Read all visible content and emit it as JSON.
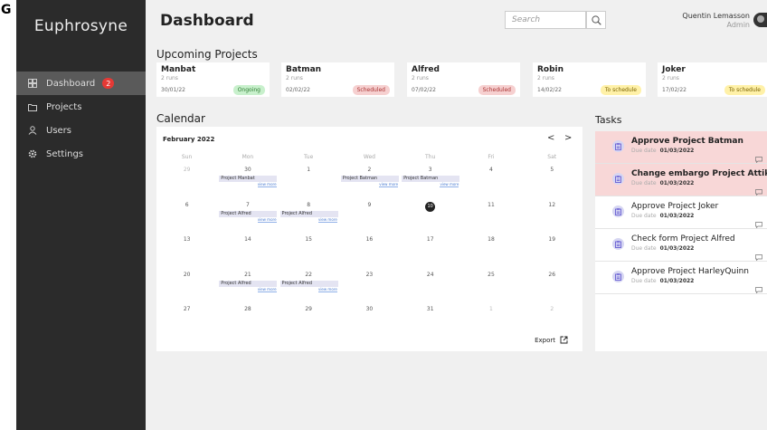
{
  "edge": {
    "glyph": "G"
  },
  "sidebar": {
    "brand": "Euphrosyne",
    "items": [
      {
        "label": "Dashboard",
        "badge": "2",
        "icon": "dashboard-icon",
        "active": true
      },
      {
        "label": "Projects",
        "icon": "folder-icon"
      },
      {
        "label": "Users",
        "icon": "user-icon"
      },
      {
        "label": "Settings",
        "icon": "gear-icon"
      }
    ]
  },
  "header": {
    "title": "Dashboard",
    "search_placeholder": "Search",
    "user_name": "Quentin Lemasson",
    "user_role": "Admin"
  },
  "projects": {
    "title": "Upcoming Projects",
    "items": [
      {
        "name": "Manbat",
        "runs": "2 runs",
        "date": "30/01/22",
        "status": "Ongoing",
        "status_color": "#c8f0cc"
      },
      {
        "name": "Batman",
        "runs": "2 runs",
        "date": "02/02/22",
        "status": "Scheduled",
        "status_color": "#f6d0d0"
      },
      {
        "name": "Alfred",
        "runs": "2 runs",
        "date": "07/02/22",
        "status": "Scheduled",
        "status_color": "#f6d0d0"
      },
      {
        "name": "Robin",
        "runs": "2 runs",
        "date": "14/02/22",
        "status": "To schedule",
        "status_color": "#fff1a8"
      },
      {
        "name": "Joker",
        "runs": "2 runs",
        "date": "17/02/22",
        "status": "To schedule",
        "status_color": "#fff1a8"
      }
    ]
  },
  "calendar": {
    "title": "Calendar",
    "month": "February 2022",
    "prev": "<",
    "next": ">",
    "weekdays": [
      "Sun",
      "Mon",
      "Tue",
      "Wed",
      "Thu",
      "Fri",
      "Sat"
    ],
    "weeks": [
      [
        {
          "d": "29",
          "muted": true
        },
        {
          "d": "30",
          "event": "Project Manbat",
          "more": "view more"
        },
        {
          "d": "1"
        },
        {
          "d": "2",
          "event": "Project Batman",
          "more": "view more"
        },
        {
          "d": "3",
          "event": "Project Batman",
          "more": "view more"
        },
        {
          "d": "4"
        },
        {
          "d": "5"
        }
      ],
      [
        {
          "d": "6"
        },
        {
          "d": "7",
          "event": "Project Alfred",
          "more": "view more"
        },
        {
          "d": "8",
          "event": "Project Alfred",
          "more": "view more"
        },
        {
          "d": "9"
        },
        {
          "d": "10",
          "today": true
        },
        {
          "d": "11"
        },
        {
          "d": "12"
        }
      ],
      [
        {
          "d": "13"
        },
        {
          "d": "14"
        },
        {
          "d": "15"
        },
        {
          "d": "16"
        },
        {
          "d": "17"
        },
        {
          "d": "18"
        },
        {
          "d": "19"
        }
      ],
      [
        {
          "d": "20"
        },
        {
          "d": "21",
          "event": "Project Alfred",
          "more": "view more"
        },
        {
          "d": "22",
          "event": "Project Alfred",
          "more": "view more"
        },
        {
          "d": "23"
        },
        {
          "d": "24"
        },
        {
          "d": "25"
        },
        {
          "d": "26"
        }
      ],
      [
        {
          "d": "27"
        },
        {
          "d": "28"
        },
        {
          "d": "29"
        },
        {
          "d": "30"
        },
        {
          "d": "31"
        },
        {
          "d": "1",
          "muted": true
        },
        {
          "d": "2",
          "muted": true
        }
      ]
    ],
    "export_label": "Export"
  },
  "tasks": {
    "title": "Tasks",
    "due_label": "Due date",
    "items": [
      {
        "title": "Approve Project Batman",
        "due": "01/03/2022",
        "urgent": true
      },
      {
        "title": "Change embargo Project Attika",
        "due": "01/03/2022",
        "urgent": true
      },
      {
        "title": "Approve Project Joker",
        "due": "01/03/2022",
        "urgent": false
      },
      {
        "title": "Check form Project Alfred",
        "due": "01/03/2022",
        "urgent": false
      },
      {
        "title": "Approve Project HarleyQuinn",
        "due": "01/03/2022",
        "urgent": false
      }
    ]
  },
  "colors": {
    "sidebar_bg": "#2b2b2b",
    "active_bg": "#5a5a5a",
    "badge": "#e53935",
    "urgent_task": "#f8d7d7",
    "event_bg": "#e4e4f2",
    "link": "#4a7bd0"
  }
}
